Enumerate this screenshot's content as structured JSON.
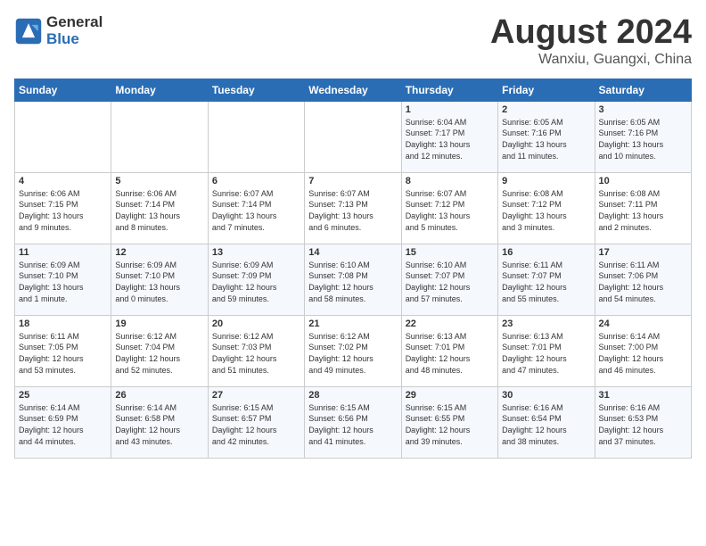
{
  "header": {
    "logo_general": "General",
    "logo_blue": "Blue",
    "month_year": "August 2024",
    "location": "Wanxiu, Guangxi, China"
  },
  "weekdays": [
    "Sunday",
    "Monday",
    "Tuesday",
    "Wednesday",
    "Thursday",
    "Friday",
    "Saturday"
  ],
  "weeks": [
    [
      {
        "day": "",
        "info": ""
      },
      {
        "day": "",
        "info": ""
      },
      {
        "day": "",
        "info": ""
      },
      {
        "day": "",
        "info": ""
      },
      {
        "day": "1",
        "info": "Sunrise: 6:04 AM\nSunset: 7:17 PM\nDaylight: 13 hours\nand 12 minutes."
      },
      {
        "day": "2",
        "info": "Sunrise: 6:05 AM\nSunset: 7:16 PM\nDaylight: 13 hours\nand 11 minutes."
      },
      {
        "day": "3",
        "info": "Sunrise: 6:05 AM\nSunset: 7:16 PM\nDaylight: 13 hours\nand 10 minutes."
      }
    ],
    [
      {
        "day": "4",
        "info": "Sunrise: 6:06 AM\nSunset: 7:15 PM\nDaylight: 13 hours\nand 9 minutes."
      },
      {
        "day": "5",
        "info": "Sunrise: 6:06 AM\nSunset: 7:14 PM\nDaylight: 13 hours\nand 8 minutes."
      },
      {
        "day": "6",
        "info": "Sunrise: 6:07 AM\nSunset: 7:14 PM\nDaylight: 13 hours\nand 7 minutes."
      },
      {
        "day": "7",
        "info": "Sunrise: 6:07 AM\nSunset: 7:13 PM\nDaylight: 13 hours\nand 6 minutes."
      },
      {
        "day": "8",
        "info": "Sunrise: 6:07 AM\nSunset: 7:12 PM\nDaylight: 13 hours\nand 5 minutes."
      },
      {
        "day": "9",
        "info": "Sunrise: 6:08 AM\nSunset: 7:12 PM\nDaylight: 13 hours\nand 3 minutes."
      },
      {
        "day": "10",
        "info": "Sunrise: 6:08 AM\nSunset: 7:11 PM\nDaylight: 13 hours\nand 2 minutes."
      }
    ],
    [
      {
        "day": "11",
        "info": "Sunrise: 6:09 AM\nSunset: 7:10 PM\nDaylight: 13 hours\nand 1 minute."
      },
      {
        "day": "12",
        "info": "Sunrise: 6:09 AM\nSunset: 7:10 PM\nDaylight: 13 hours\nand 0 minutes."
      },
      {
        "day": "13",
        "info": "Sunrise: 6:09 AM\nSunset: 7:09 PM\nDaylight: 12 hours\nand 59 minutes."
      },
      {
        "day": "14",
        "info": "Sunrise: 6:10 AM\nSunset: 7:08 PM\nDaylight: 12 hours\nand 58 minutes."
      },
      {
        "day": "15",
        "info": "Sunrise: 6:10 AM\nSunset: 7:07 PM\nDaylight: 12 hours\nand 57 minutes."
      },
      {
        "day": "16",
        "info": "Sunrise: 6:11 AM\nSunset: 7:07 PM\nDaylight: 12 hours\nand 55 minutes."
      },
      {
        "day": "17",
        "info": "Sunrise: 6:11 AM\nSunset: 7:06 PM\nDaylight: 12 hours\nand 54 minutes."
      }
    ],
    [
      {
        "day": "18",
        "info": "Sunrise: 6:11 AM\nSunset: 7:05 PM\nDaylight: 12 hours\nand 53 minutes."
      },
      {
        "day": "19",
        "info": "Sunrise: 6:12 AM\nSunset: 7:04 PM\nDaylight: 12 hours\nand 52 minutes."
      },
      {
        "day": "20",
        "info": "Sunrise: 6:12 AM\nSunset: 7:03 PM\nDaylight: 12 hours\nand 51 minutes."
      },
      {
        "day": "21",
        "info": "Sunrise: 6:12 AM\nSunset: 7:02 PM\nDaylight: 12 hours\nand 49 minutes."
      },
      {
        "day": "22",
        "info": "Sunrise: 6:13 AM\nSunset: 7:01 PM\nDaylight: 12 hours\nand 48 minutes."
      },
      {
        "day": "23",
        "info": "Sunrise: 6:13 AM\nSunset: 7:01 PM\nDaylight: 12 hours\nand 47 minutes."
      },
      {
        "day": "24",
        "info": "Sunrise: 6:14 AM\nSunset: 7:00 PM\nDaylight: 12 hours\nand 46 minutes."
      }
    ],
    [
      {
        "day": "25",
        "info": "Sunrise: 6:14 AM\nSunset: 6:59 PM\nDaylight: 12 hours\nand 44 minutes."
      },
      {
        "day": "26",
        "info": "Sunrise: 6:14 AM\nSunset: 6:58 PM\nDaylight: 12 hours\nand 43 minutes."
      },
      {
        "day": "27",
        "info": "Sunrise: 6:15 AM\nSunset: 6:57 PM\nDaylight: 12 hours\nand 42 minutes."
      },
      {
        "day": "28",
        "info": "Sunrise: 6:15 AM\nSunset: 6:56 PM\nDaylight: 12 hours\nand 41 minutes."
      },
      {
        "day": "29",
        "info": "Sunrise: 6:15 AM\nSunset: 6:55 PM\nDaylight: 12 hours\nand 39 minutes."
      },
      {
        "day": "30",
        "info": "Sunrise: 6:16 AM\nSunset: 6:54 PM\nDaylight: 12 hours\nand 38 minutes."
      },
      {
        "day": "31",
        "info": "Sunrise: 6:16 AM\nSunset: 6:53 PM\nDaylight: 12 hours\nand 37 minutes."
      }
    ]
  ]
}
